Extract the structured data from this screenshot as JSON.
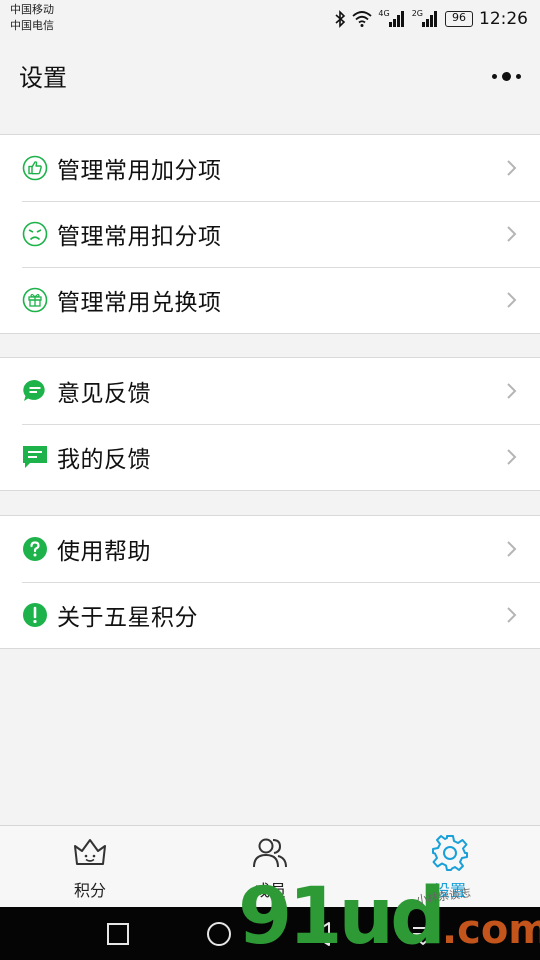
{
  "status_bar": {
    "carrier_1": "中国移动",
    "carrier_2": "中国电信",
    "net_1": "4G",
    "net_2": "2G",
    "battery": "96",
    "time": "12:26"
  },
  "header": {
    "title": "设置",
    "more_icon": "more-dots-icon"
  },
  "groups": [
    {
      "items": [
        {
          "label": "管理常用加分项",
          "icon": "thumbs-up-icon"
        },
        {
          "label": "管理常用扣分项",
          "icon": "sad-face-icon"
        },
        {
          "label": "管理常用兑换项",
          "icon": "gift-icon"
        }
      ]
    },
    {
      "items": [
        {
          "label": "意见反馈",
          "icon": "chat-bubble-icon"
        },
        {
          "label": "我的反馈",
          "icon": "message-icon"
        }
      ]
    },
    {
      "items": [
        {
          "label": "使用帮助",
          "icon": "question-icon"
        },
        {
          "label": "关于五星积分",
          "icon": "info-exclamation-icon"
        }
      ]
    }
  ],
  "tab_bar": {
    "tabs": [
      {
        "label": "积分",
        "icon": "crown-icon",
        "active": false
      },
      {
        "label": "成员",
        "icon": "users-icon",
        "active": false
      },
      {
        "label": "设置",
        "icon": "gear-icon",
        "active": true
      }
    ]
  },
  "colors": {
    "accent_green": "#1db24a",
    "active_tab": "#1aa0d8",
    "background": "#f3f3f3"
  },
  "watermark": {
    "text": "91ud",
    "suffix": ".com",
    "tag": "小林杂谈志"
  }
}
